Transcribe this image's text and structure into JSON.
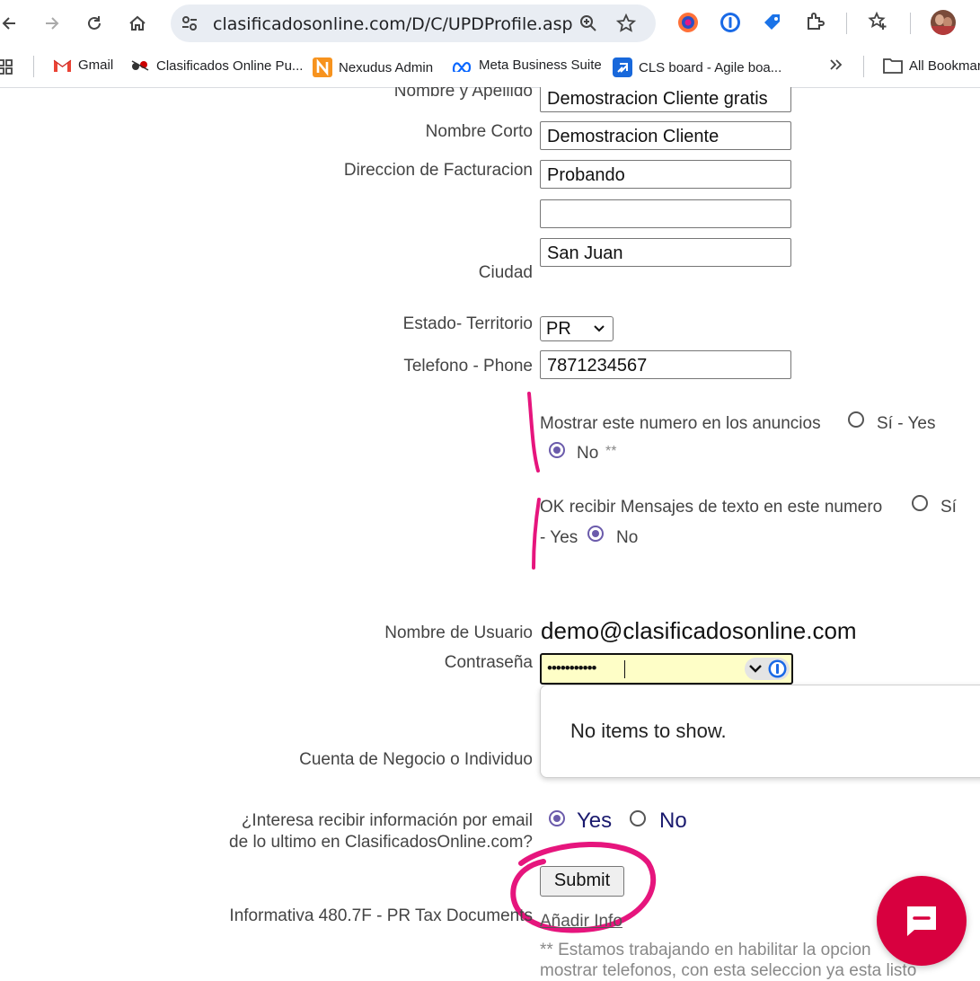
{
  "browser": {
    "url": "clasificadosonline.com/D/C/UPDProfile.asp",
    "bookmarks": [
      {
        "label": "Gmail",
        "icon": "gmail-icon"
      },
      {
        "label": "Clasificados Online Pu...",
        "icon": "clasificados-icon"
      },
      {
        "label": "Nexudus Admin",
        "icon": "nexudus-icon"
      },
      {
        "label": "Meta Business Suite",
        "icon": "meta-icon"
      },
      {
        "label": "CLS board - Agile boa...",
        "icon": "jira-icon"
      }
    ],
    "all_bookmarks_label": "All Bookmarks"
  },
  "form": {
    "nombre_label": "Nombre y Apellido",
    "nombre_value": "Demostracion Cliente gratis",
    "nombre_corto_label": "Nombre Corto",
    "nombre_corto_value": "Demostracion Cliente",
    "direccion_label": "Direccion de Facturacion",
    "direccion_1": "Probando",
    "direccion_2": "",
    "ciudad_label": "Ciudad",
    "ciudad_value": "San Juan",
    "estado_label": "Estado- Territorio",
    "estado_value": "PR",
    "telefono_label": "Telefono - Phone",
    "telefono_value": "7871234567",
    "mostrar_text": "Mostrar este numero en los anuncios",
    "mostrar_yes": "Sí - Yes",
    "mostrar_no": "No",
    "mostrar_note": "**",
    "sms_text": "OK recibir Mensajes de texto en este numero",
    "sms_yes_1": "Sí",
    "sms_yes_2": "- Yes",
    "sms_no": "No",
    "usuario_label": "Nombre de Usuario",
    "usuario_value": "demo@clasificadosonline.com",
    "password_label": "Contraseña",
    "password_value": "•••••••••••",
    "dropdown_text": "No items to show.",
    "cuenta_label": "Cuenta de Negocio o Individuo",
    "email_q_1": "¿Interesa recibir información por email",
    "email_q_2": "de lo ultimo en ClasificadosOnline.com?",
    "email_yes": "Yes",
    "email_no": "No",
    "submit_label": "Submit",
    "informativa_label": "Informativa 480.7F - PR Tax Documents",
    "anadir_link": "Añadir Info",
    "footnote_1": "** Estamos trabajando en habilitar la opcion",
    "footnote_2": "mostrar telefonos, con esta seleccion ya esta listo"
  },
  "colors": {
    "annotation": "#e6157d",
    "radio_checked": "#6b5bab",
    "chat_widget": "#d8003f"
  }
}
